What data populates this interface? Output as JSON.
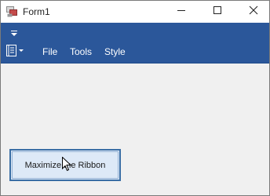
{
  "window": {
    "title": "Form1",
    "icons": {
      "app": "form-app-icon",
      "minimize": "minimize-icon",
      "maximize": "maximize-icon",
      "close": "close-icon"
    }
  },
  "quick_access": {
    "icon": "chevron-down-icon"
  },
  "ribbon": {
    "app_menu_icon": "application-menu-icon",
    "tabs": [
      {
        "label": "File"
      },
      {
        "label": "Tools"
      },
      {
        "label": "Style"
      }
    ],
    "background_color": "#2b579a"
  },
  "main": {
    "button_label": "Maximize the Ribbon",
    "background_color": "#f0f0f0"
  },
  "colors": {
    "accent": "#2b579a",
    "button_fill": "#dde9f7",
    "button_border": "#3a6ea5"
  }
}
